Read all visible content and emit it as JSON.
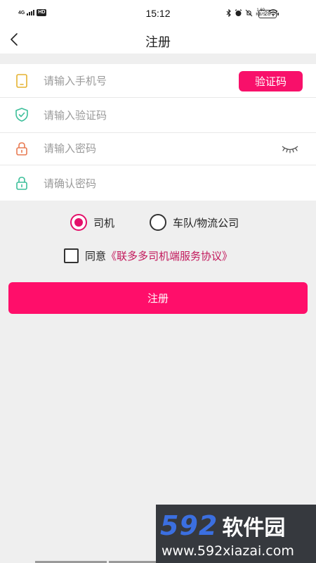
{
  "status_bar": {
    "network": "4G",
    "hd": "HD",
    "time": "15:12",
    "net_speed_value": "1.60",
    "net_speed_unit": "KB/S",
    "battery": "28"
  },
  "nav": {
    "title": "注册"
  },
  "form": {
    "phone_placeholder": "请输入手机号",
    "get_code_label": "验证码",
    "code_placeholder": "请输入验证码",
    "password_placeholder": "请输入密码",
    "confirm_placeholder": "请确认密码"
  },
  "roles": {
    "driver_label": "司机",
    "fleet_label": "车队/物流公司",
    "selected": "司机"
  },
  "agreement": {
    "prefix": "同意",
    "link": "《联多多司机端服务协议》",
    "checked": false
  },
  "submit_label": "注册",
  "watermark": {
    "number": "592",
    "brand": "软件园",
    "url": "www.592xiazai.com"
  },
  "colors": {
    "accent": "#ff0e6a",
    "phone_icon": "#e5b230",
    "shield_icon": "#3dbf9a",
    "lock_icon": "#e87b53",
    "lock_confirm_icon": "#3dbf9a"
  },
  "icons": {
    "back": "back-arrow-icon",
    "phone": "phone-icon",
    "code": "shield-check-icon",
    "password": "lock-icon",
    "confirm": "lock-icon",
    "eye": "eye-closed-icon"
  }
}
